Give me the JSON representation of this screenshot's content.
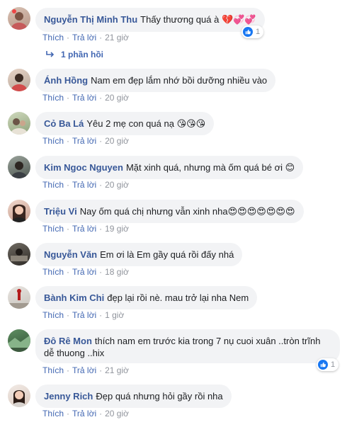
{
  "actions": {
    "like": "Thích",
    "reply": "Trả lời"
  },
  "replies_link": "1 phần hồi",
  "comments": [
    {
      "name": "Nguyễn Thị Minh Thu",
      "text": "Thấy thương quá à",
      "emoji": "💔💞💞",
      "time": "21 giờ",
      "reactions": "1"
    },
    {
      "name": "Ánh Hồng",
      "text": "Nam em đẹp lắm nhớ bồi dưỡng nhiều vào",
      "emoji": "",
      "time": "20 giờ"
    },
    {
      "name": "Cỏ Ba Lá",
      "text": "Yêu 2 mẹ con quá nạ",
      "emoji": "😘😘😘",
      "time": "20 giờ"
    },
    {
      "name": "Kim Ngoc Nguyen",
      "text": "Mặt xinh quá, nhưng mà ốm quá bé ơi",
      "emoji": "😊",
      "time": "20 giờ"
    },
    {
      "name": "Triệu Vi",
      "text": "Nay ốm quá chị nhưng vẫn xinh nha",
      "emoji": "😍😍😍😍😍😍😍",
      "time": "19 giờ"
    },
    {
      "name": "Nguyễn Văn",
      "text": "Em ơi là Em gầy quá rồi đấy nhá",
      "emoji": "",
      "time": "18 giờ"
    },
    {
      "name": "Bành Kim Chi",
      "text": "đẹp lại rồi nè. mau trở lại nha Nem",
      "emoji": "",
      "time": "1 giờ"
    },
    {
      "name": "Đô Rê Mon",
      "text": "thích nam em trước kia trong 7 nụ cuoi xuân ..tròn trĩnh dễ thuong ..hix",
      "emoji": "",
      "time": "21 giờ",
      "reactions": "1"
    },
    {
      "name": "Jenny Rich",
      "text": "Đẹp quá nhưng hỏi gầy rồi nha",
      "emoji": "",
      "time": "20 giờ"
    }
  ],
  "colors": {
    "name": "#385898",
    "link": "#4267b2",
    "meta": "#90949c",
    "bubble": "#f2f3f5",
    "like": "#1877f2"
  }
}
